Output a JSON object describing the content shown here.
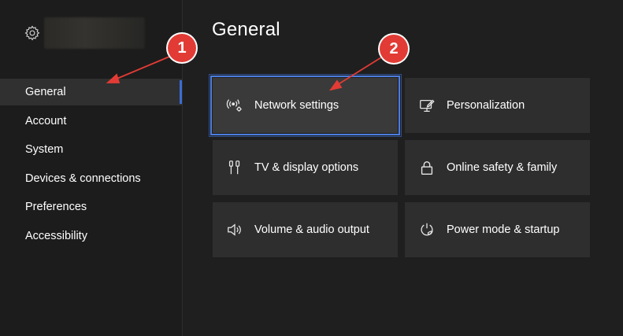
{
  "sidebar": {
    "items": [
      {
        "label": "General",
        "active": true
      },
      {
        "label": "Account",
        "active": false
      },
      {
        "label": "System",
        "active": false
      },
      {
        "label": "Devices & connections",
        "active": false
      },
      {
        "label": "Preferences",
        "active": false
      },
      {
        "label": "Accessibility",
        "active": false
      }
    ]
  },
  "main": {
    "title": "General",
    "tiles": [
      {
        "label": "Network settings",
        "icon": "network-icon",
        "focused": true
      },
      {
        "label": "Personalization",
        "icon": "personalization-icon"
      },
      {
        "label": "TV & display options",
        "icon": "tv-display-icon"
      },
      {
        "label": "Online safety & family",
        "icon": "lock-icon"
      },
      {
        "label": "Volume & audio output",
        "icon": "speaker-icon"
      },
      {
        "label": "Power mode & startup",
        "icon": "power-icon"
      }
    ]
  },
  "annotations": [
    {
      "number": "1"
    },
    {
      "number": "2"
    }
  ],
  "colors": {
    "accent": "#3b6cd6",
    "focus_outline": "#4c7ddf",
    "annotation": "#e23b35"
  }
}
